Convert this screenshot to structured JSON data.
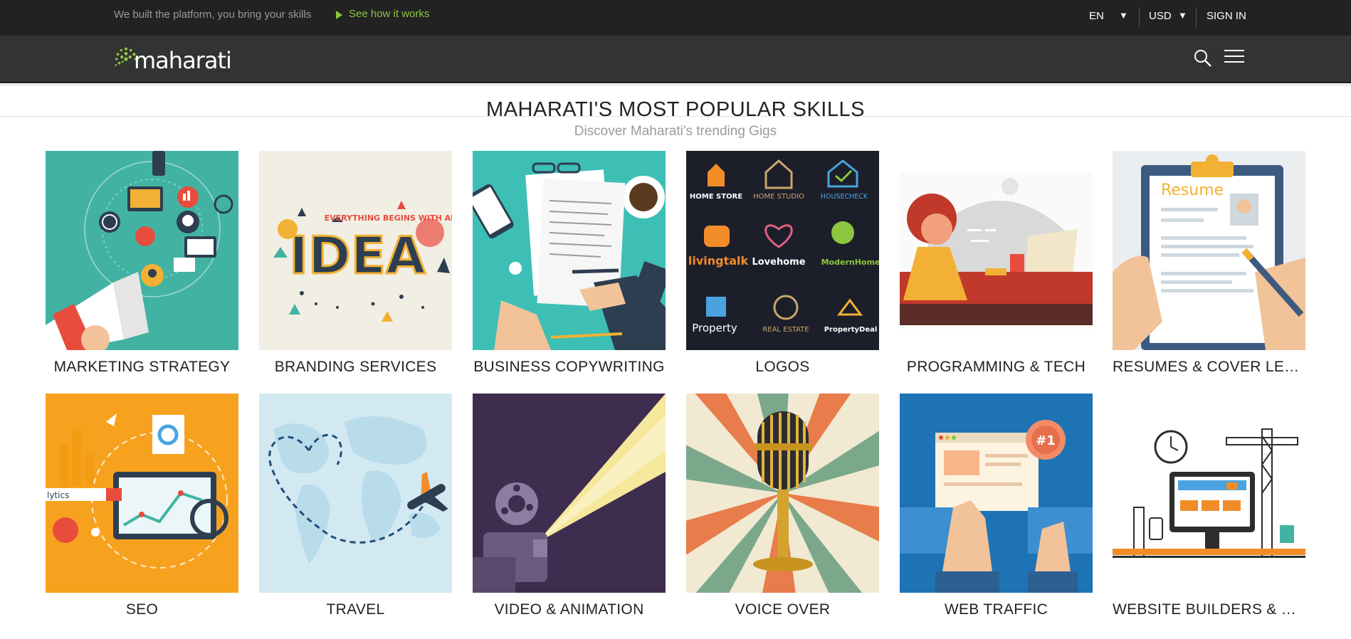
{
  "topbar": {
    "tagline": "We built the platform, you bring your skills",
    "cta": "See how it works",
    "language": "EN",
    "currency": "USD",
    "signin": "SIGN IN",
    "accent": "#8cc63f"
  },
  "nav": {
    "brand": "maharati",
    "icons": [
      "search-icon",
      "hamburger-menu-icon"
    ]
  },
  "section": {
    "title": "MAHARATI'S MOST POPULAR SKILLS",
    "subtitle": "Discover Maharati's trending Gigs"
  },
  "categories": [
    {
      "label": "MARKETING STRATEGY"
    },
    {
      "label": "BRANDING SERVICES"
    },
    {
      "label": "BUSINESS COPYWRITING"
    },
    {
      "label": "LOGOS"
    },
    {
      "label": "PROGRAMMING & TECH"
    },
    {
      "label": "RESUMES & COVER LETTE..."
    },
    {
      "label": "SEO"
    },
    {
      "label": "TRAVEL"
    },
    {
      "label": "VIDEO & ANIMATION"
    },
    {
      "label": "VOICE OVER"
    },
    {
      "label": "WEB TRAFFIC"
    },
    {
      "label": "WEBSITE BUILDERS & CMS"
    }
  ],
  "art": {
    "idea_banner": "EVERYTHING BEGINS WITH AN",
    "idea_word": "IDEA",
    "resume_heading": "Resume",
    "seo_search": "lytics",
    "web_badge": "#1",
    "logos": [
      "HOME STORE",
      "HOME STUDIO",
      "HOUSECHECK",
      "livingtalk",
      "Lovehome",
      "ModernHome",
      "Property",
      "REAL ESTATE",
      "PropertyDeal"
    ]
  }
}
